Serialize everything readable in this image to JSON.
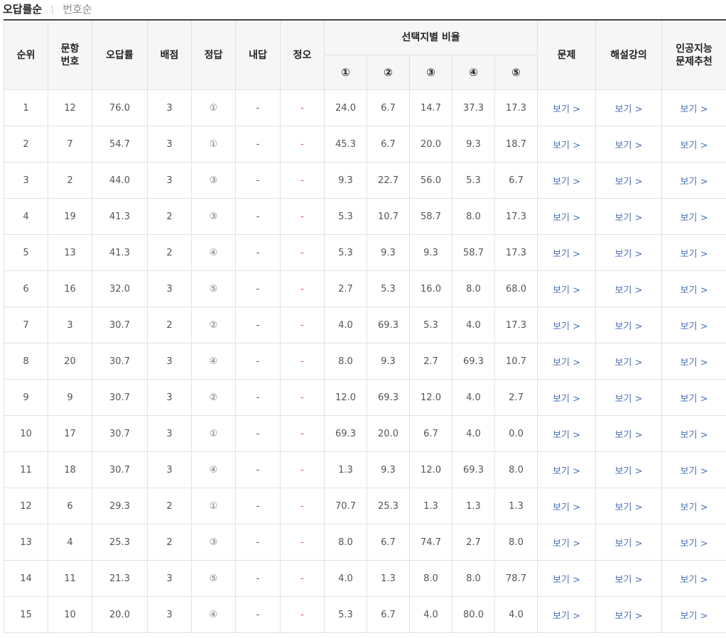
{
  "sort_tabs": {
    "active": "오답률순",
    "inactive": "번호순"
  },
  "headers": {
    "rank": "순위",
    "qnum": "문항\n번호",
    "wrong_rate": "오답률",
    "score": "배점",
    "answer": "정답",
    "my_answer": "내답",
    "correctness": "정오",
    "choice_ratio": "선택지별 비율",
    "choices": [
      "①",
      "②",
      "③",
      "④",
      "⑤"
    ],
    "problem": "문제",
    "lecture": "해설강의",
    "ai": "인공지능\n문제추천"
  },
  "link_label": "보기 >",
  "rows": [
    {
      "rank": "1",
      "qnum": "12",
      "wrong_rate": "76.0",
      "score": "3",
      "answer": "①",
      "my_answer": "-",
      "correctness": "-",
      "ratios": [
        "24.0",
        "6.7",
        "14.7",
        "37.3",
        "17.3"
      ]
    },
    {
      "rank": "2",
      "qnum": "7",
      "wrong_rate": "54.7",
      "score": "3",
      "answer": "①",
      "my_answer": "-",
      "correctness": "-",
      "ratios": [
        "45.3",
        "6.7",
        "20.0",
        "9.3",
        "18.7"
      ]
    },
    {
      "rank": "3",
      "qnum": "2",
      "wrong_rate": "44.0",
      "score": "3",
      "answer": "③",
      "my_answer": "-",
      "correctness": "-",
      "ratios": [
        "9.3",
        "22.7",
        "56.0",
        "5.3",
        "6.7"
      ]
    },
    {
      "rank": "4",
      "qnum": "19",
      "wrong_rate": "41.3",
      "score": "2",
      "answer": "③",
      "my_answer": "-",
      "correctness": "-",
      "ratios": [
        "5.3",
        "10.7",
        "58.7",
        "8.0",
        "17.3"
      ]
    },
    {
      "rank": "5",
      "qnum": "13",
      "wrong_rate": "41.3",
      "score": "2",
      "answer": "④",
      "my_answer": "-",
      "correctness": "-",
      "ratios": [
        "5.3",
        "9.3",
        "9.3",
        "58.7",
        "17.3"
      ]
    },
    {
      "rank": "6",
      "qnum": "16",
      "wrong_rate": "32.0",
      "score": "3",
      "answer": "⑤",
      "my_answer": "-",
      "correctness": "-",
      "ratios": [
        "2.7",
        "5.3",
        "16.0",
        "8.0",
        "68.0"
      ]
    },
    {
      "rank": "7",
      "qnum": "3",
      "wrong_rate": "30.7",
      "score": "2",
      "answer": "②",
      "my_answer": "-",
      "correctness": "-",
      "ratios": [
        "4.0",
        "69.3",
        "5.3",
        "4.0",
        "17.3"
      ]
    },
    {
      "rank": "8",
      "qnum": "20",
      "wrong_rate": "30.7",
      "score": "3",
      "answer": "④",
      "my_answer": "-",
      "correctness": "-",
      "ratios": [
        "8.0",
        "9.3",
        "2.7",
        "69.3",
        "10.7"
      ]
    },
    {
      "rank": "9",
      "qnum": "9",
      "wrong_rate": "30.7",
      "score": "3",
      "answer": "②",
      "my_answer": "-",
      "correctness": "-",
      "ratios": [
        "12.0",
        "69.3",
        "12.0",
        "4.0",
        "2.7"
      ]
    },
    {
      "rank": "10",
      "qnum": "17",
      "wrong_rate": "30.7",
      "score": "3",
      "answer": "①",
      "my_answer": "-",
      "correctness": "-",
      "ratios": [
        "69.3",
        "20.0",
        "6.7",
        "4.0",
        "0.0"
      ]
    },
    {
      "rank": "11",
      "qnum": "18",
      "wrong_rate": "30.7",
      "score": "3",
      "answer": "④",
      "my_answer": "-",
      "correctness": "-",
      "ratios": [
        "1.3",
        "9.3",
        "12.0",
        "69.3",
        "8.0"
      ]
    },
    {
      "rank": "12",
      "qnum": "6",
      "wrong_rate": "29.3",
      "score": "2",
      "answer": "①",
      "my_answer": "-",
      "correctness": "-",
      "ratios": [
        "70.7",
        "25.3",
        "1.3",
        "1.3",
        "1.3"
      ]
    },
    {
      "rank": "13",
      "qnum": "4",
      "wrong_rate": "25.3",
      "score": "2",
      "answer": "③",
      "my_answer": "-",
      "correctness": "-",
      "ratios": [
        "8.0",
        "6.7",
        "74.7",
        "2.7",
        "8.0"
      ]
    },
    {
      "rank": "14",
      "qnum": "11",
      "wrong_rate": "21.3",
      "score": "3",
      "answer": "⑤",
      "my_answer": "-",
      "correctness": "-",
      "ratios": [
        "4.0",
        "1.3",
        "8.0",
        "8.0",
        "78.7"
      ]
    },
    {
      "rank": "15",
      "qnum": "10",
      "wrong_rate": "20.0",
      "score": "3",
      "answer": "④",
      "my_answer": "-",
      "correctness": "-",
      "ratios": [
        "5.3",
        "6.7",
        "4.0",
        "80.0",
        "4.0"
      ]
    }
  ],
  "colors": {
    "link": "#4a6fb5",
    "wrong_mark": "#d9534f",
    "header_bg": "#f6f6f6",
    "border": "#e2e2e2",
    "top_border": "#444444"
  }
}
